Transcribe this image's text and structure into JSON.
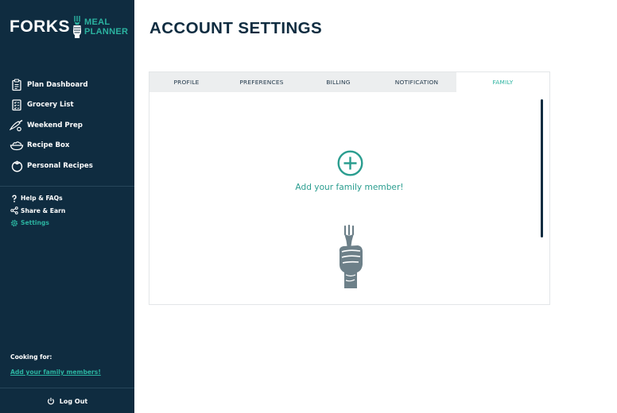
{
  "brand": {
    "word": "FORKS",
    "sub_line1": "MEAL",
    "sub_line2": "PLANNER"
  },
  "page_title": "ACCOUNT SETTINGS",
  "sidebar": {
    "main_items": [
      {
        "label": "Plan Dashboard",
        "icon": "clipboard-icon"
      },
      {
        "label": "Grocery List",
        "icon": "grocery-list-icon"
      },
      {
        "label": "Weekend Prep",
        "icon": "knife-icon"
      },
      {
        "label": "Recipe Box",
        "icon": "bowl-icon"
      },
      {
        "label": "Personal Recipes",
        "icon": "tomato-icon"
      }
    ],
    "secondary_items": [
      {
        "label": "Help & FAQs",
        "icon": "question-icon"
      },
      {
        "label": "Share & Earn",
        "icon": "share-icon"
      },
      {
        "label": "Settings",
        "icon": "gear-icon",
        "active": true
      }
    ],
    "cooking_for_label": "Cooking for:",
    "add_family_link": "Add your family members!",
    "logout_label": "Log Out"
  },
  "tabs": [
    {
      "label": "PROFILE"
    },
    {
      "label": "PREFERENCES"
    },
    {
      "label": "BILLING"
    },
    {
      "label": "NOTIFICATION"
    },
    {
      "label": "FAMILY",
      "active": true
    }
  ],
  "family": {
    "add_label": "Add your family member!"
  },
  "colors": {
    "sidebar_bg": "#0f2c40",
    "accent": "#2bb3a0",
    "tab_bar": "#eceeef",
    "mascot": "#6d8089"
  }
}
